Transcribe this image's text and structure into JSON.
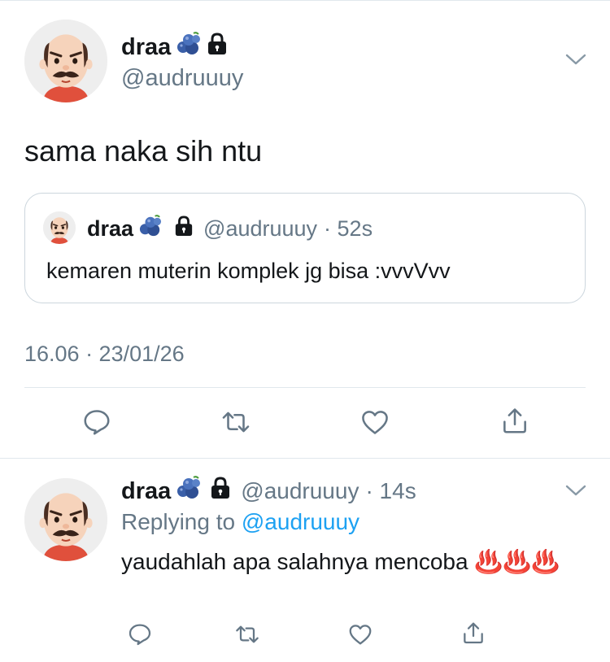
{
  "main_tweet": {
    "author_name": "draa",
    "author_handle": "@audruuuy",
    "text": "sama naka sih ntu",
    "timestamp": "16.06 · 23/01/26"
  },
  "quoted_tweet": {
    "author_name": "draa",
    "author_handle": "@audruuuy",
    "time_ago": "· 52s",
    "text": "kemaren muterin komplek jg bisa :vvvVvv"
  },
  "reply_tweet": {
    "author_name": "draa",
    "author_handle": "@audruuuy",
    "time_ago": "· 14s",
    "replying_label": "Replying to",
    "replying_handle": "@audruuuy",
    "text": "yaudahlah apa salahnya mencoba ♨️♨️♨️"
  },
  "icons": {
    "name_emoji": "blueberries-icon",
    "protected": "lock-icon",
    "menu": "chevron-down-icon",
    "actions": [
      "reply-icon",
      "retweet-icon",
      "like-icon",
      "share-icon"
    ]
  },
  "colors": {
    "link": "#1da1f2",
    "secondary_text": "#657786",
    "icon_gray": "#657786",
    "divider": "#e1e8ed"
  }
}
